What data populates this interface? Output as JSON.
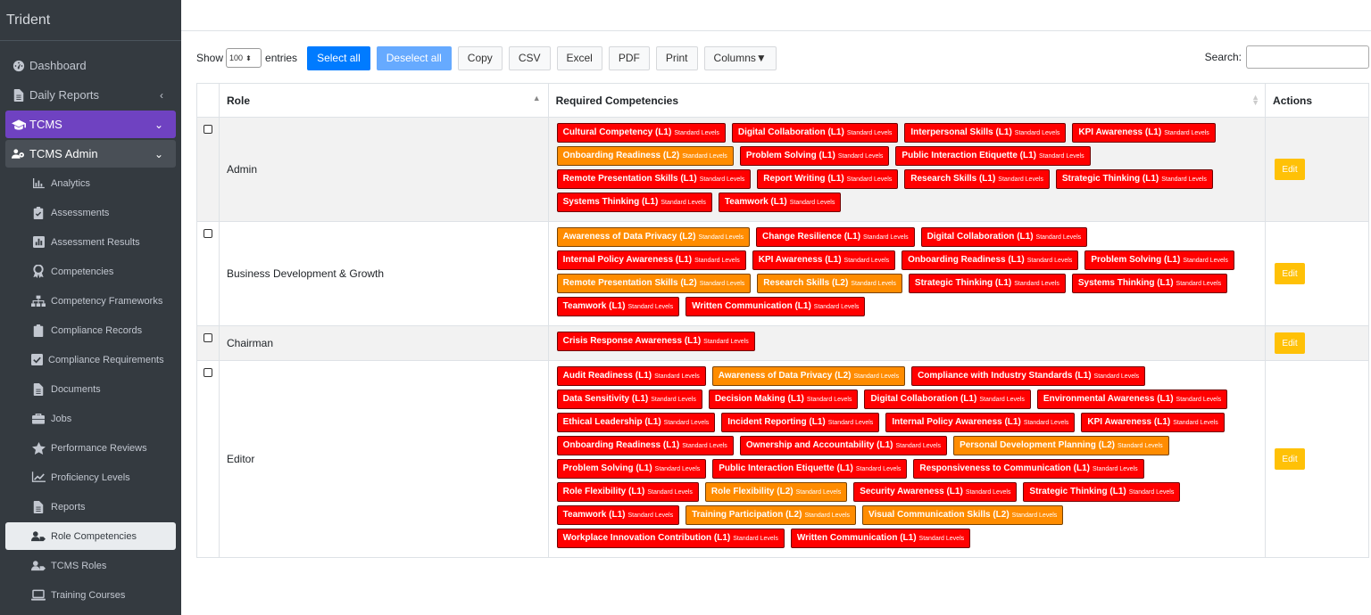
{
  "app": {
    "title": "Trident"
  },
  "sidebar": {
    "items": [
      {
        "label": "Dashboard",
        "icon": "dashboard-icon"
      },
      {
        "label": "Daily Reports",
        "icon": "file-icon",
        "chevron": "‹"
      },
      {
        "label": "TCMS",
        "icon": "graduation-cap-icon",
        "chevron": "⌄"
      },
      {
        "label": "TCMS Admin",
        "icon": "users-cog-icon",
        "chevron": "⌄"
      }
    ],
    "sub_items": [
      {
        "label": "Analytics",
        "icon": "chart-bar-icon"
      },
      {
        "label": "Assessments",
        "icon": "clipboard-check-icon"
      },
      {
        "label": "Assessment Results",
        "icon": "poll-icon"
      },
      {
        "label": "Competencies",
        "icon": "award-icon"
      },
      {
        "label": "Competency Frameworks",
        "icon": "sitemap-icon"
      },
      {
        "label": "Compliance Records",
        "icon": "clipboard-icon"
      },
      {
        "label": "Compliance Requirements",
        "icon": "check-square-icon"
      },
      {
        "label": "Documents",
        "icon": "file-icon"
      },
      {
        "label": "Jobs",
        "icon": "briefcase-icon"
      },
      {
        "label": "Performance Reviews",
        "icon": "star-icon"
      },
      {
        "label": "Proficiency Levels",
        "icon": "chart-line-icon"
      },
      {
        "label": "Reports",
        "icon": "file-alt-icon"
      },
      {
        "label": "Role Competencies",
        "icon": "user-tag-icon"
      },
      {
        "label": "TCMS Roles",
        "icon": "user-tag-icon"
      },
      {
        "label": "Training Courses",
        "icon": "laptop-icon"
      }
    ]
  },
  "toolbar": {
    "show_label": "Show",
    "entries_value": "100",
    "entries_label": "entries",
    "select_all": "Select all",
    "deselect_all": "Deselect all",
    "copy": "Copy",
    "csv": "CSV",
    "excel": "Excel",
    "pdf": "PDF",
    "print": "Print",
    "columns": "Columns▼",
    "search_label": "Search:"
  },
  "table": {
    "headers": {
      "role": "Role",
      "competencies": "Required Competencies",
      "actions": "Actions"
    },
    "edit_label": "Edit",
    "level_note": "Standard Levels",
    "rows": [
      {
        "role": "Admin",
        "badges": [
          {
            "text": "Cultural Competency (L1)",
            "color": "red"
          },
          {
            "text": "Digital Collaboration (L1)",
            "color": "red"
          },
          {
            "text": "Interpersonal Skills (L1)",
            "color": "red"
          },
          {
            "text": "KPI Awareness (L1)",
            "color": "red"
          },
          {
            "text": "Onboarding Readiness (L2)",
            "color": "orange"
          },
          {
            "text": "Problem Solving (L1)",
            "color": "red"
          },
          {
            "text": "Public Interaction Etiquette (L1)",
            "color": "red"
          },
          {
            "text": "Remote Presentation Skills (L1)",
            "color": "red"
          },
          {
            "text": "Report Writing (L1)",
            "color": "red"
          },
          {
            "text": "Research Skills (L1)",
            "color": "red"
          },
          {
            "text": "Strategic Thinking (L1)",
            "color": "red"
          },
          {
            "text": "Systems Thinking (L1)",
            "color": "red"
          },
          {
            "text": "Teamwork (L1)",
            "color": "red"
          }
        ]
      },
      {
        "role": "Business Development & Growth",
        "badges": [
          {
            "text": "Awareness of Data Privacy (L2)",
            "color": "orange"
          },
          {
            "text": "Change Resilience (L1)",
            "color": "red"
          },
          {
            "text": "Digital Collaboration (L1)",
            "color": "red"
          },
          {
            "text": "Internal Policy Awareness (L1)",
            "color": "red"
          },
          {
            "text": "KPI Awareness (L1)",
            "color": "red"
          },
          {
            "text": "Onboarding Readiness (L1)",
            "color": "red"
          },
          {
            "text": "Problem Solving (L1)",
            "color": "red"
          },
          {
            "text": "Remote Presentation Skills (L2)",
            "color": "orange"
          },
          {
            "text": "Research Skills (L2)",
            "color": "orange"
          },
          {
            "text": "Strategic Thinking (L1)",
            "color": "red"
          },
          {
            "text": "Systems Thinking (L1)",
            "color": "red"
          },
          {
            "text": "Teamwork (L1)",
            "color": "red"
          },
          {
            "text": "Written Communication (L1)",
            "color": "red"
          }
        ]
      },
      {
        "role": "Chairman",
        "badges": [
          {
            "text": "Crisis Response Awareness (L1)",
            "color": "red"
          }
        ]
      },
      {
        "role": "Editor",
        "badges": [
          {
            "text": "Audit Readiness (L1)",
            "color": "red"
          },
          {
            "text": "Awareness of Data Privacy (L2)",
            "color": "orange"
          },
          {
            "text": "Compliance with Industry Standards (L1)",
            "color": "red"
          },
          {
            "text": "Data Sensitivity (L1)",
            "color": "red"
          },
          {
            "text": "Decision Making (L1)",
            "color": "red"
          },
          {
            "text": "Digital Collaboration (L1)",
            "color": "red"
          },
          {
            "text": "Environmental Awareness (L1)",
            "color": "red"
          },
          {
            "text": "Ethical Leadership (L1)",
            "color": "red"
          },
          {
            "text": "Incident Reporting (L1)",
            "color": "red"
          },
          {
            "text": "Internal Policy Awareness (L1)",
            "color": "red"
          },
          {
            "text": "KPI Awareness (L1)",
            "color": "red"
          },
          {
            "text": "Onboarding Readiness (L1)",
            "color": "red"
          },
          {
            "text": "Ownership and Accountability (L1)",
            "color": "red"
          },
          {
            "text": "Personal Development Planning (L2)",
            "color": "orange"
          },
          {
            "text": "Problem Solving (L1)",
            "color": "red"
          },
          {
            "text": "Public Interaction Etiquette (L1)",
            "color": "red"
          },
          {
            "text": "Responsiveness to Communication (L1)",
            "color": "red"
          },
          {
            "text": "Role Flexibility (L1)",
            "color": "red"
          },
          {
            "text": "Role Flexibility (L2)",
            "color": "orange"
          },
          {
            "text": "Security Awareness (L1)",
            "color": "red"
          },
          {
            "text": "Strategic Thinking (L1)",
            "color": "red"
          },
          {
            "text": "Teamwork (L1)",
            "color": "red"
          },
          {
            "text": "Training Participation (L2)",
            "color": "orange"
          },
          {
            "text": "Visual Communication Skills (L2)",
            "color": "orange"
          },
          {
            "text": "Workplace Innovation Contribution (L1)",
            "color": "red"
          },
          {
            "text": "Written Communication (L1)",
            "color": "red"
          }
        ]
      }
    ]
  },
  "colors": {
    "sidebar_bg": "#343a40",
    "active_purple": "#6f42c1",
    "primary": "#007bff",
    "badge_red": "#ff0000",
    "badge_orange": "#ff8c00",
    "edit_yellow": "#ffc107"
  }
}
